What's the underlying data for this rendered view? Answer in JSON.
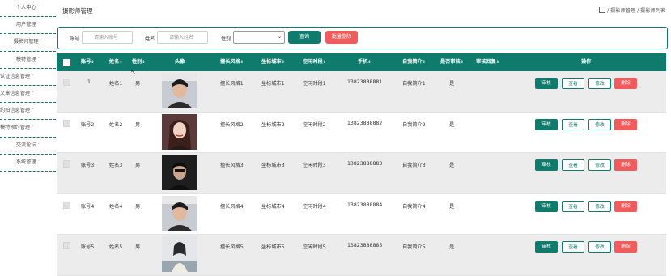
{
  "sidebar": {
    "items": [
      {
        "label": "个人中心"
      },
      {
        "label": "用户管理"
      },
      {
        "label": "摄影师管理"
      },
      {
        "label": "模特管理"
      },
      {
        "label": "认证信息管理"
      },
      {
        "label": "文章信息管理"
      },
      {
        "label": "约拍信息管理"
      },
      {
        "label": "模特预约管理"
      },
      {
        "label": "交流论坛"
      },
      {
        "label": "系统管理"
      }
    ]
  },
  "header": {
    "title": "摄影师管理",
    "breadcrumb": "/ 摄影师管理 / 摄影师列表"
  },
  "search": {
    "account_label": "账号",
    "account_placeholder": "请输入账号",
    "name_label": "姓名",
    "name_placeholder": "请输入姓名",
    "gender_label": "性别",
    "gender_value": "",
    "query_label": "查询",
    "batch_delete_label": "批量删除"
  },
  "table": {
    "headers": [
      "账号",
      "姓名",
      "性别",
      "头像",
      "擅长风格",
      "坐标城市",
      "空闲时段",
      "手机",
      "自我简介",
      "是否审核",
      "审核回复",
      "操作"
    ],
    "actions": {
      "review": "审核",
      "view": "查看",
      "edit": "修改",
      "delete": "删除"
    },
    "rows": [
      {
        "account": "1",
        "name": "姓名1",
        "gender": "男",
        "style": "擅长风格1",
        "city": "坐标城市1",
        "time": "空闲时段1",
        "phone": "13823888881",
        "intro": "自我简介1",
        "reviewed": "是",
        "reply": ""
      },
      {
        "account": "账号2",
        "name": "姓名2",
        "gender": "男",
        "style": "擅长风格2",
        "city": "坐标城市2",
        "time": "空闲时段2",
        "phone": "13823888882",
        "intro": "自我简介2",
        "reviewed": "是",
        "reply": ""
      },
      {
        "account": "账号3",
        "name": "姓名3",
        "gender": "男",
        "style": "擅长风格3",
        "city": "坐标城市3",
        "time": "空闲时段3",
        "phone": "13823888883",
        "intro": "自我简介3",
        "reviewed": "是",
        "reply": ""
      },
      {
        "account": "账号4",
        "name": "姓名4",
        "gender": "男",
        "style": "擅长风格4",
        "city": "坐标城市4",
        "time": "空闲时段4",
        "phone": "13823888884",
        "intro": "自我简介4",
        "reviewed": "是",
        "reply": ""
      },
      {
        "account": "账号5",
        "name": "姓名5",
        "gender": "男",
        "style": "擅长风格5",
        "city": "坐标城市5",
        "time": "空闲时段5",
        "phone": "13823888885",
        "intro": "自我简介5",
        "reviewed": "是",
        "reply": ""
      }
    ]
  },
  "colors": {
    "primary": "#0f7b6c",
    "danger": "#f15b5b",
    "row_alt": "#ececec"
  },
  "icons": {
    "home": "home-icon",
    "sort": "sort-icon",
    "dropdown": "chevron-down-icon",
    "cursor": "mouse-cursor-icon"
  }
}
